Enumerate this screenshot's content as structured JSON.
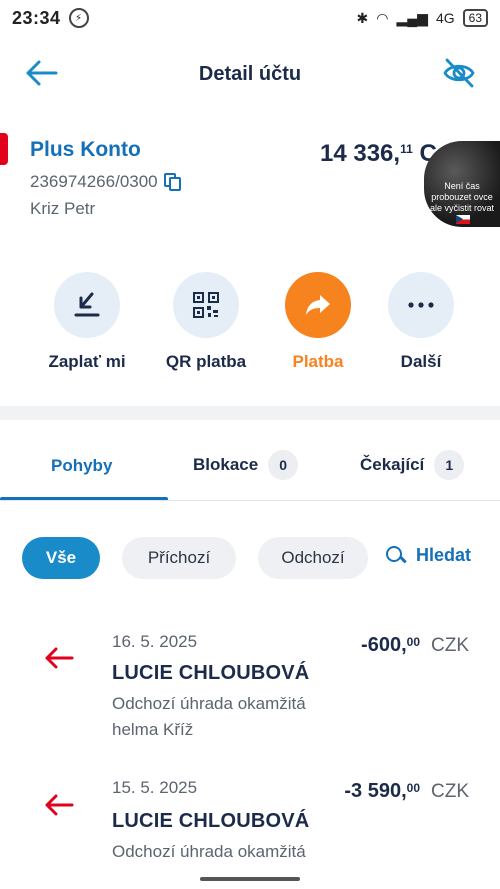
{
  "status_bar": {
    "time": "23:34",
    "network": "4G",
    "battery": "63"
  },
  "header": {
    "title": "Detail účtu"
  },
  "account": {
    "name_part1": "Plus ",
    "name_part2": "Konto",
    "number": "236974266/0300",
    "owner": "Kriz Petr",
    "balance_int": "14 336,",
    "balance_dec": "11",
    "balance_trail": "C"
  },
  "overlay": {
    "line1": "Není čas",
    "line2": "probouzet ovce",
    "line3": "ale vyčistit rovat"
  },
  "actions": [
    {
      "label": "Zaplať mi",
      "icon": "request-money-icon"
    },
    {
      "label": "QR platba",
      "icon": "qr-code-icon"
    },
    {
      "label": "Platba",
      "icon": "share-arrow-icon"
    },
    {
      "label": "Další",
      "icon": "more-icon"
    }
  ],
  "tabs": [
    {
      "label": "Pohyby",
      "count": null
    },
    {
      "label": "Blokace",
      "count": "0"
    },
    {
      "label": "Čekající",
      "count": "1"
    }
  ],
  "filters": {
    "chips": [
      "Vše",
      "Příchozí",
      "Odchozí"
    ],
    "search_label": "Hledat"
  },
  "transactions": [
    {
      "date": "16. 5. 2025",
      "name": "LUCIE CHLOUBOVÁ",
      "description": "Odchozí úhrada okamžitá",
      "note": "helma Kříž",
      "amount_int": "-600,",
      "amount_dec": "00",
      "currency": "CZK"
    },
    {
      "date": "15. 5. 2025",
      "name": "LUCIE CHLOUBOVÁ",
      "description": "Odchozí úhrada okamžitá",
      "note": "",
      "amount_int": "-3 590,",
      "amount_dec": "00",
      "currency": "CZK"
    }
  ],
  "colors": {
    "brand_blue": "#1570b8",
    "accent_orange": "#f7831e",
    "outgoing_red": "#e3001b",
    "chip_active": "#1a8bc9"
  }
}
